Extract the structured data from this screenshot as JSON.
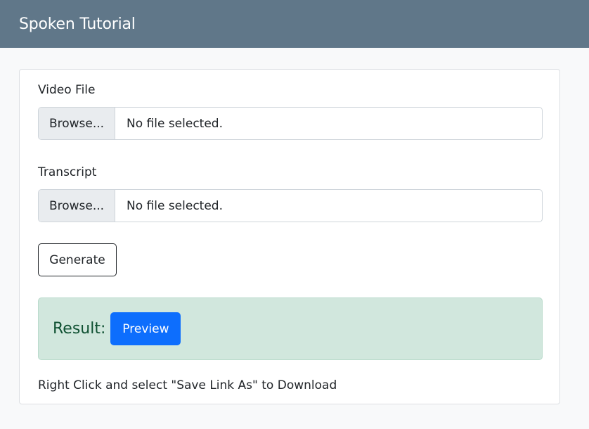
{
  "navbar": {
    "brand": "Spoken Tutorial"
  },
  "form": {
    "video": {
      "label": "Video File",
      "browse_label": "Browse...",
      "status": "No file selected."
    },
    "transcript": {
      "label": "Transcript",
      "browse_label": "Browse...",
      "status": "No file selected."
    },
    "generate_label": "Generate"
  },
  "result": {
    "label": "Result:",
    "preview_label": "Preview"
  },
  "note": "Right Click and select \"Save Link As\" to Download",
  "colors": {
    "navbar": "#607789",
    "result_bg": "#d1e7dd",
    "result_text": "#0f5132",
    "preview_button": "#0d6efd"
  }
}
